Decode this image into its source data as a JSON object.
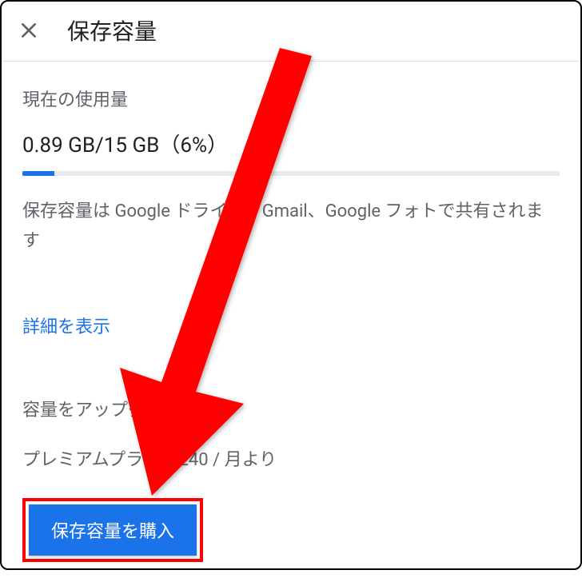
{
  "header": {
    "title": "保存容量"
  },
  "usage": {
    "label": "現在の使用量",
    "used": "0.89 GB",
    "total": "15 GB",
    "percent_label": "（6%）",
    "percent_value": 6,
    "display": "0.89 GB/15 GB（6%）"
  },
  "description": "保存容量は Google ドライブ、Gmail、Google フォトで共有されます",
  "details_link": "詳細を表示",
  "upgrade": {
    "label": "容量をアップグレード",
    "premium_text": "プレミアムプラン: ¥240 / 月より",
    "button_label": "保存容量を購入"
  },
  "colors": {
    "accent": "#1a73e8",
    "highlight": "#ff0000"
  }
}
